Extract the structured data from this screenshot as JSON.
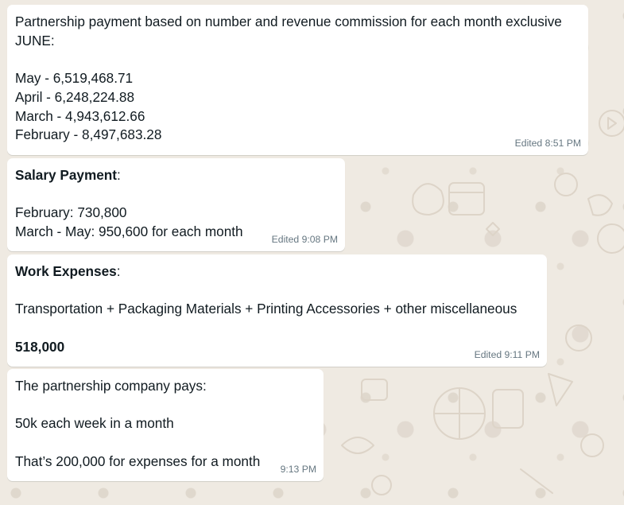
{
  "messages": [
    {
      "lines": [
        "Partnership payment based on number and revenue commission for each month exclusive",
        "JUNE:",
        "",
        "May - 6,519,468.71",
        "April - 6,248,224.88",
        "March - 4,943,612.66",
        "February - 8,497,683.28"
      ],
      "meta": "Edited 8:51 PM"
    },
    {
      "heading": "Salary Payment",
      "heading_suffix": ":",
      "lines": [
        "February: 730,800",
        "March - May: 950,600 for each month"
      ],
      "meta": "Edited 9:08 PM"
    },
    {
      "heading": "Work Expenses",
      "heading_suffix": ":",
      "lines": [
        "Transportation + Packaging Materials + Printing Accessories + other miscellaneous"
      ],
      "total": "518,000",
      "meta": "Edited 9:11 PM"
    },
    {
      "lines": [
        "The partnership company pays:",
        "50k each week in a month",
        "That’s 200,000 for expenses for a month"
      ],
      "meta": "9:13 PM"
    }
  ],
  "colors": {
    "bubble": "#ffffff",
    "wallpaper": "#efeae2",
    "meta_text": "#667781",
    "body_text": "#111b21"
  }
}
